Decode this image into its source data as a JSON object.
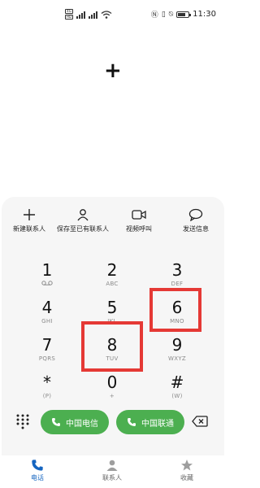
{
  "status_bar": {
    "sim1": "4G",
    "sim2": "HD",
    "time": "11:30"
  },
  "display": {
    "number": "+"
  },
  "actions": [
    {
      "label": "新建联系人",
      "icon": "add-icon"
    },
    {
      "label": "保存至已有联系人",
      "icon": "person-icon"
    },
    {
      "label": "视频呼叫",
      "icon": "video-icon"
    },
    {
      "label": "发送信息",
      "icon": "message-icon"
    }
  ],
  "keys": [
    {
      "digit": "1",
      "letters": "ᴑᴑ"
    },
    {
      "digit": "2",
      "letters": "ABC"
    },
    {
      "digit": "3",
      "letters": "DEF"
    },
    {
      "digit": "4",
      "letters": "GHI"
    },
    {
      "digit": "5",
      "letters": "JKL"
    },
    {
      "digit": "6",
      "letters": "MNO"
    },
    {
      "digit": "7",
      "letters": "PQRS"
    },
    {
      "digit": "8",
      "letters": "TUV"
    },
    {
      "digit": "9",
      "letters": "WXYZ"
    },
    {
      "digit": "*",
      "letters": "(P)"
    },
    {
      "digit": "0",
      "letters": "+"
    },
    {
      "digit": "#",
      "letters": "(W)"
    }
  ],
  "call_buttons": {
    "sim1_label": "中国电信",
    "sim2_label": "中国联通"
  },
  "tabs": [
    {
      "label": "电话",
      "active": true
    },
    {
      "label": "联系人",
      "active": false
    },
    {
      "label": "收藏",
      "active": false
    }
  ],
  "colors": {
    "highlight": "#e53935",
    "call_green": "#4caf50",
    "active_tab": "#1565c0"
  }
}
